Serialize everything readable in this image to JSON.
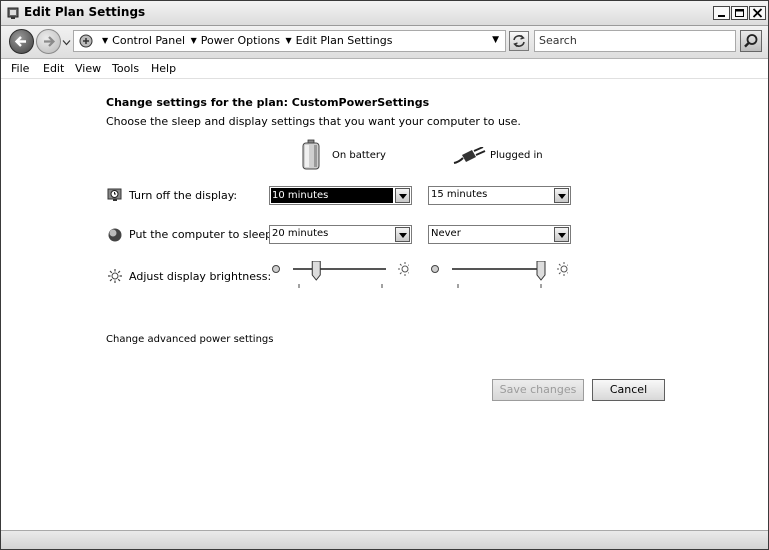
{
  "window": {
    "title": "Edit Plan Settings"
  },
  "address": {
    "crumbs": [
      "Control Panel",
      "Power Options",
      "Edit Plan Settings"
    ],
    "search_placeholder": "Search"
  },
  "menu": [
    "File",
    "Edit",
    "View",
    "Tools",
    "Help"
  ],
  "content": {
    "heading": "Change settings for the plan: CustomPowerSettings",
    "subheading": "Choose the sleep and display settings that you want your computer to use.",
    "columns": {
      "battery": "On battery",
      "plugged": "Plugged in"
    },
    "rows": {
      "display": {
        "label": "Turn off the display:",
        "battery": "10 minutes",
        "plugged": "15 minutes"
      },
      "sleep": {
        "label": "Put the computer to sleep:",
        "battery": "20 minutes",
        "plugged": "Never"
      },
      "brightness": {
        "label": "Adjust display brightness:",
        "battery_level": 0.25,
        "plugged_level": 1.0
      }
    },
    "advanced_link": "Change advanced power settings",
    "buttons": {
      "save": "Save changes",
      "cancel": "Cancel"
    }
  },
  "icons": {
    "display_row": "monitor-clock-icon",
    "sleep_row": "moon-icon",
    "brightness_row": "sun-icon",
    "battery_column": "battery-icon",
    "plugged_column": "power-plug-icon"
  }
}
